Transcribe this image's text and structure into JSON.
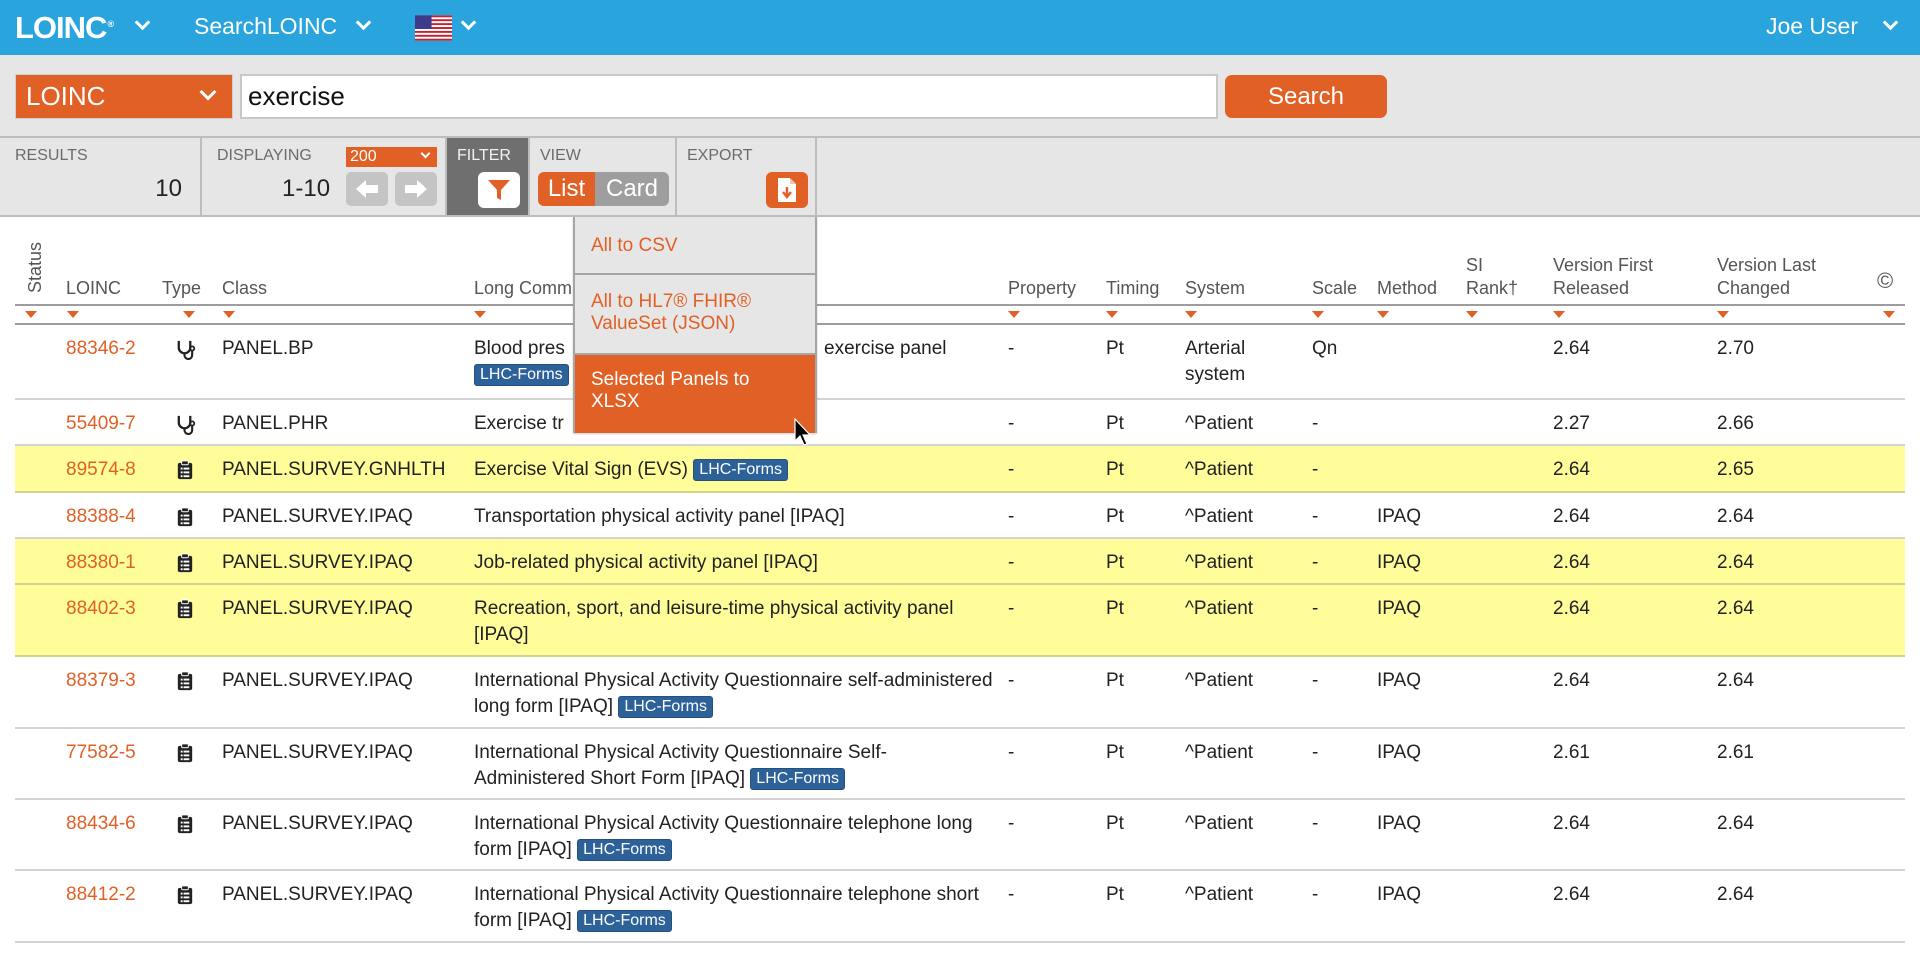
{
  "topbar": {
    "logo": "LOINC",
    "logo_mark": "®",
    "app_menu": "SearchLOINC",
    "language": "us-flag-icon",
    "user": "Joe User"
  },
  "search": {
    "database": "LOINC",
    "query": "exercise",
    "button": "Search"
  },
  "toolbar": {
    "results_label": "RESULTS",
    "results_count": "10",
    "displaying_label": "DISPLAYING",
    "per_page": "200",
    "range": "1-10",
    "filter_label": "FILTER",
    "view_label": "VIEW",
    "view_list": "List",
    "view_card": "Card",
    "view_selected": "List",
    "export_label": "EXPORT"
  },
  "export_menu": {
    "items": [
      {
        "label": "All to CSV"
      },
      {
        "label": "All to HL7® FHIR® ValueSet (JSON)"
      },
      {
        "label": "Selected Panels to XLSX",
        "hovered": true
      }
    ]
  },
  "table": {
    "columns": {
      "status": "Status",
      "loinc": "LOINC",
      "type": "Type",
      "class": "Class",
      "long_name": "Long Comm",
      "property": "Property",
      "timing": "Timing",
      "system": "System",
      "scale": "Scale",
      "method": "Method",
      "si_rank_1": "SI",
      "si_rank_2": "Rank†",
      "version_first_1": "Version First",
      "version_first_2": "Released",
      "version_last_1": "Version Last",
      "version_last_2": "Changed",
      "copyright": "©"
    },
    "badge_label": "LHC-Forms",
    "rows": [
      {
        "loinc": "88346-2",
        "type": "stethoscope",
        "class": "PANEL.BP",
        "long_name_start": "Blood pres",
        "long_name_end": "exercise panel",
        "lhc_forms": true,
        "property": "-",
        "timing": "Pt",
        "system": "Arterial system",
        "scale": "Qn",
        "method": "",
        "version_first": "2.64",
        "version_last": "2.70",
        "highlighted": false
      },
      {
        "loinc": "55409-7",
        "type": "stethoscope",
        "class": "PANEL.PHR",
        "long_name": "Exercise tr",
        "lhc_forms": false,
        "property": "-",
        "timing": "Pt",
        "system": "^Patient",
        "scale": "-",
        "method": "",
        "version_first": "2.27",
        "version_last": "2.66",
        "highlighted": false
      },
      {
        "loinc": "89574-8",
        "type": "clipboard",
        "class": "PANEL.SURVEY.GNHLTH",
        "long_name": "Exercise Vital Sign (EVS)",
        "lhc_forms": true,
        "property": "-",
        "timing": "Pt",
        "system": "^Patient",
        "scale": "-",
        "method": "",
        "version_first": "2.64",
        "version_last": "2.65",
        "highlighted": true
      },
      {
        "loinc": "88388-4",
        "type": "clipboard",
        "class": "PANEL.SURVEY.IPAQ",
        "long_name": "Transportation physical activity panel [IPAQ]",
        "lhc_forms": false,
        "property": "-",
        "timing": "Pt",
        "system": "^Patient",
        "scale": "-",
        "method": "IPAQ",
        "version_first": "2.64",
        "version_last": "2.64",
        "highlighted": false
      },
      {
        "loinc": "88380-1",
        "type": "clipboard",
        "class": "PANEL.SURVEY.IPAQ",
        "long_name": "Job-related physical activity panel [IPAQ]",
        "lhc_forms": false,
        "property": "-",
        "timing": "Pt",
        "system": "^Patient",
        "scale": "-",
        "method": "IPAQ",
        "version_first": "2.64",
        "version_last": "2.64",
        "highlighted": true
      },
      {
        "loinc": "88402-3",
        "type": "clipboard",
        "class": "PANEL.SURVEY.IPAQ",
        "long_name": "Recreation, sport, and leisure-time physical activity panel [IPAQ]",
        "lhc_forms": false,
        "property": "-",
        "timing": "Pt",
        "system": "^Patient",
        "scale": "-",
        "method": "IPAQ",
        "version_first": "2.64",
        "version_last": "2.64",
        "highlighted": true
      },
      {
        "loinc": "88379-3",
        "type": "clipboard",
        "class": "PANEL.SURVEY.IPAQ",
        "long_name": "International Physical Activity Questionnaire self-administered long form [IPAQ]",
        "lhc_forms": true,
        "property": "-",
        "timing": "Pt",
        "system": "^Patient",
        "scale": "-",
        "method": "IPAQ",
        "version_first": "2.64",
        "version_last": "2.64",
        "highlighted": false
      },
      {
        "loinc": "77582-5",
        "type": "clipboard",
        "class": "PANEL.SURVEY.IPAQ",
        "long_name": "International Physical Activity Questionnaire Self-Administered Short Form [IPAQ]",
        "lhc_forms": true,
        "property": "-",
        "timing": "Pt",
        "system": "^Patient",
        "scale": "-",
        "method": "IPAQ",
        "version_first": "2.61",
        "version_last": "2.61",
        "highlighted": false
      },
      {
        "loinc": "88434-6",
        "type": "clipboard",
        "class": "PANEL.SURVEY.IPAQ",
        "long_name": "International Physical Activity Questionnaire telephone long form [IPAQ]",
        "lhc_forms": true,
        "property": "-",
        "timing": "Pt",
        "system": "^Patient",
        "scale": "-",
        "method": "IPAQ",
        "version_first": "2.64",
        "version_last": "2.64",
        "highlighted": false
      },
      {
        "loinc": "88412-2",
        "type": "clipboard",
        "class": "PANEL.SURVEY.IPAQ",
        "long_name": "International Physical Activity Questionnaire telephone short form [IPAQ]",
        "lhc_forms": true,
        "property": "-",
        "timing": "Pt",
        "system": "^Patient",
        "scale": "-",
        "method": "IPAQ",
        "version_first": "2.64",
        "version_last": "2.64",
        "highlighted": false
      }
    ]
  },
  "colors": {
    "header_blue": "#29a4dd",
    "accent_orange": "#e06026",
    "highlight_yellow": "#fffd99",
    "badge_blue": "#2d6199"
  }
}
